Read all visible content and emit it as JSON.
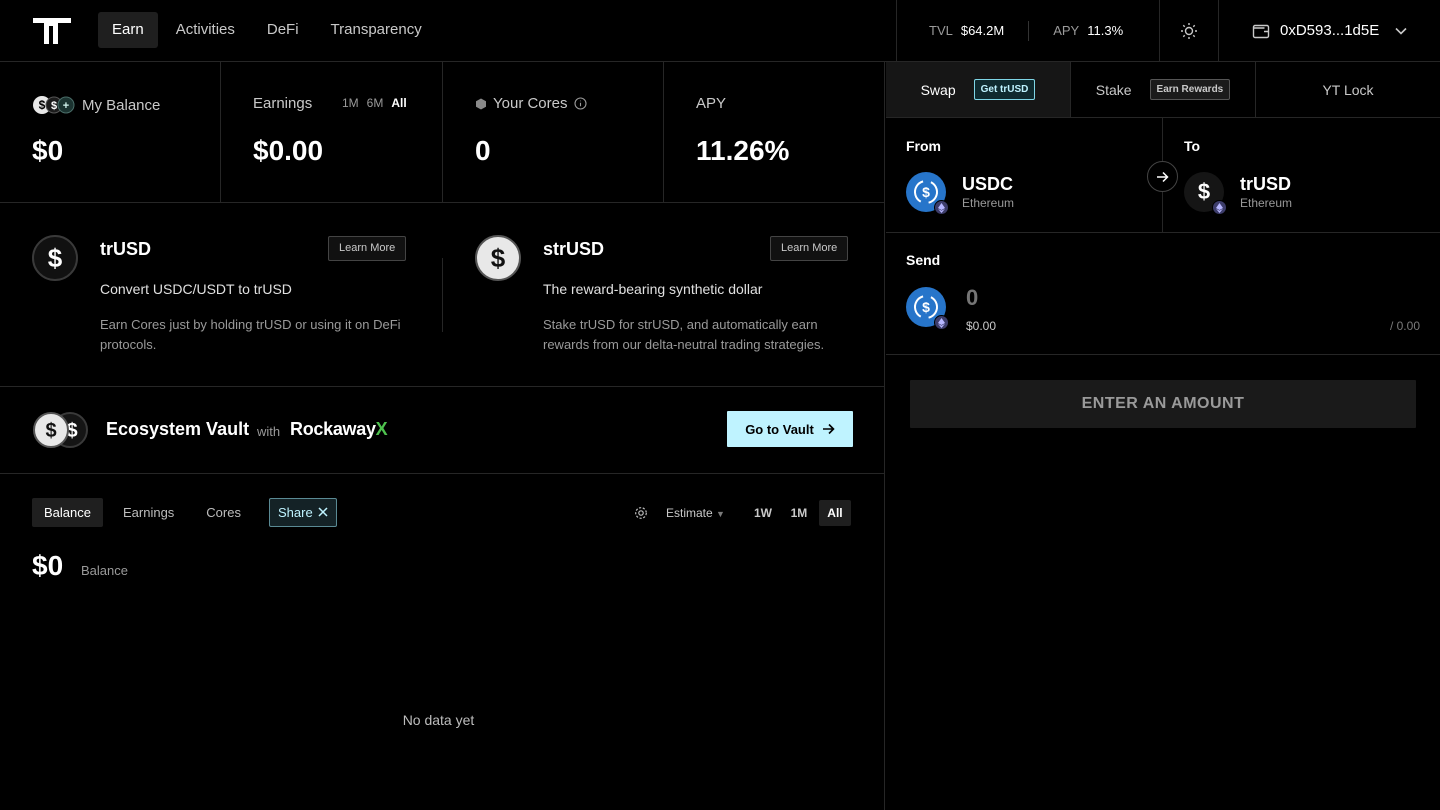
{
  "nav": {
    "items": [
      {
        "label": "Earn",
        "active": true
      },
      {
        "label": "Activities",
        "active": false
      },
      {
        "label": "DeFi",
        "active": false
      },
      {
        "label": "Transparency",
        "active": false
      }
    ]
  },
  "header": {
    "tvl_label": "TVL",
    "tvl_value": "$64.2M",
    "apy_label": "APY",
    "apy_value": "11.3%",
    "wallet_address": "0xD593...1d5E",
    "theme_icon": "sun-icon",
    "wallet_icon": "wallet-icon"
  },
  "stats": {
    "balance": {
      "label": "My Balance",
      "value": "$0"
    },
    "earnings": {
      "label": "Earnings",
      "value": "$0.00",
      "periods": [
        "1M",
        "6M",
        "All"
      ],
      "active_period": "All"
    },
    "cores": {
      "label": "Your Cores",
      "value": "0"
    },
    "apy": {
      "label": "APY",
      "value": "11.26%"
    }
  },
  "tokens": [
    {
      "name": "trUSD",
      "learn_more": "Learn More",
      "subtitle": "Convert USDC/USDT to trUSD",
      "description": "Earn Cores just by holding trUSD or using it on DeFi protocols."
    },
    {
      "name": "strUSD",
      "learn_more": "Learn More",
      "subtitle": "The reward-bearing synthetic dollar",
      "description": "Stake trUSD for strUSD, and automatically earn rewards from our delta-neutral trading strategies."
    }
  ],
  "vault": {
    "title": "Ecosystem Vault",
    "with": "with",
    "brand": "Rockaway",
    "brand_suffix": "X",
    "cta": "Go to Vault"
  },
  "chart": {
    "tabs": [
      "Balance",
      "Earnings",
      "Cores"
    ],
    "active_tab": "Balance",
    "share_label": "Share",
    "estimate_label": "Estimate",
    "ranges": [
      "1W",
      "1M",
      "All"
    ],
    "active_range": "All",
    "balance_value": "$0",
    "balance_label": "Balance",
    "empty_text": "No data yet"
  },
  "swap": {
    "tabs": [
      {
        "label": "Swap",
        "pill": "Get trUSD",
        "active": true
      },
      {
        "label": "Stake",
        "pill": "Earn Rewards",
        "active": false
      },
      {
        "label": "YT Lock",
        "pill": "",
        "active": false
      }
    ],
    "from_label": "From",
    "from_token": "USDC",
    "from_chain": "Ethereum",
    "to_label": "To",
    "to_token": "trUSD",
    "to_chain": "Ethereum",
    "send_label": "Send",
    "send_placeholder": "0",
    "send_usd": "$0.00",
    "send_max": "/ 0.00",
    "submit_label": "ENTER AN AMOUNT"
  },
  "colors": {
    "accent": "#bff3ff",
    "usdc": "#2775ca",
    "rockaway_x": "#4ec24e",
    "background": "#000000"
  }
}
